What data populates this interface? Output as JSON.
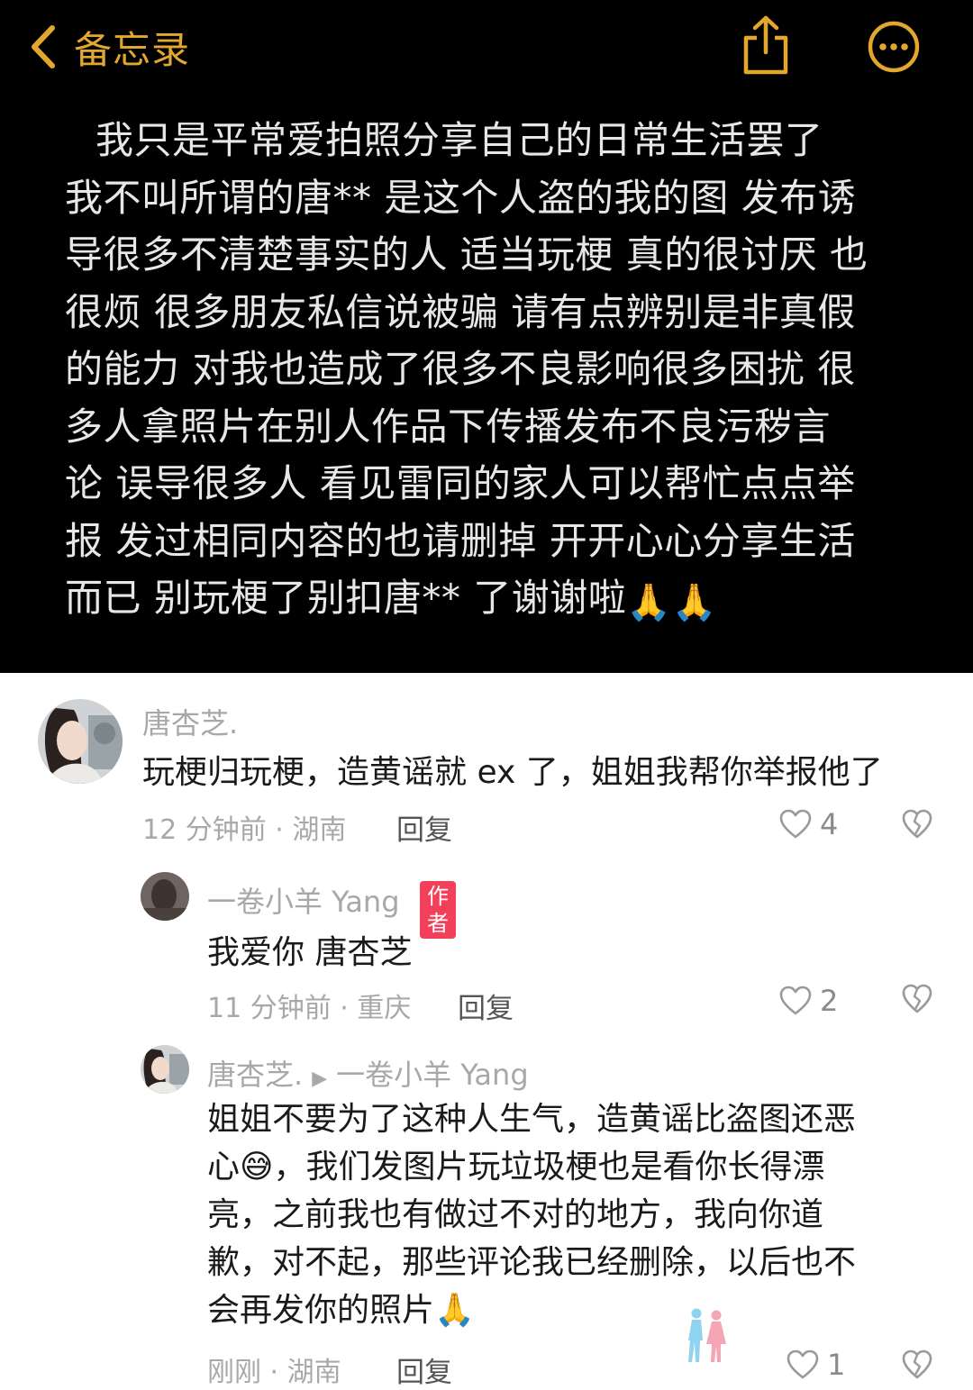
{
  "nav": {
    "back_label": "备忘录"
  },
  "note": {
    "lines": [
      "我只是平常爱拍照分享自己的日常生活罢了",
      "我不叫所谓的唐** 是这个人盗的我的图 发布诱",
      "导很多不清楚事实的人 适当玩梗 真的很讨厌 也",
      "很烦 很多朋友私信说被骗 请有点辨别是非真假",
      "的能力  对我也造成了很多不良影响很多困扰 很",
      "多人拿照片在别人作品下传播发布不良污秽言",
      "论 误导很多人 看见雷同的家人可以帮忙点点举",
      "报 发过相同内容的也请删掉 开开心心分享生活",
      "而已 别玩梗了别扣唐** 了谢谢啦"
    ],
    "emoji": "🙏🙏"
  },
  "comments": [
    {
      "author": "唐杏芝.",
      "text": "玩梗归玩梗，造黄谣就 ex 了，姐姐我帮你举报他了",
      "time_location": "12 分钟前 · 湖南",
      "reply_label": "回复",
      "likes": "4"
    },
    {
      "author": "一卷小羊 Yang",
      "badge": "作者",
      "text": "我爱你 唐杏芝",
      "time_location": "11 分钟前 · 重庆",
      "reply_label": "回复",
      "likes": "2"
    },
    {
      "author": "唐杏芝.",
      "reply_to": "一卷小羊 Yang",
      "text_lines": [
        "姐姐不要为了这种人生气，造黄谣比盗图还恶",
        "心😅，我们发图片玩垃圾梗也是看你长得漂",
        "亮，之前我也有做过不对的地方，我向你道",
        "歉，对不起，那些评论我已经删除，以后也不",
        "会再发你的照片🙏"
      ],
      "time_location": "刚刚 · 湖南",
      "reply_label": "回复",
      "likes": "1"
    }
  ],
  "colors": {
    "accent": "#e3a72e",
    "author_badge": "#f2405b",
    "notes_bg": "#000000"
  },
  "icons": [
    "chevron-left-icon",
    "share-icon",
    "more-icon",
    "heart-icon",
    "broken-heart-icon",
    "couple-watermark-icon"
  ]
}
